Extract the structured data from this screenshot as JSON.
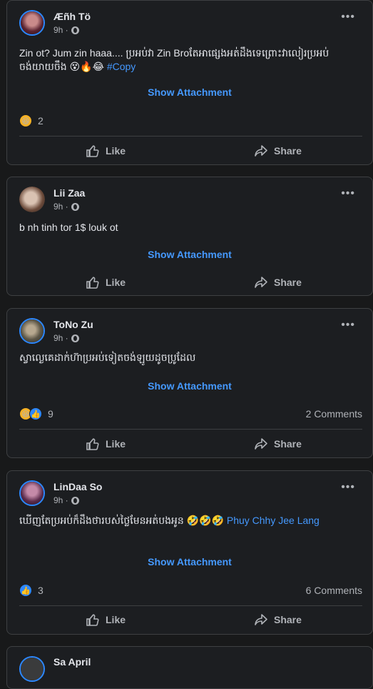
{
  "posts": [
    {
      "author": "Æñh Tö",
      "time": "9h ·",
      "text": "Zin ot? Jum zin haaa.... ប្រអប់វា Zin Broតែអាផ្សេងអត់ដឹងទេព្រោះវាលៀរប្រអប់ ចង់យាយចឹង 😵🔥😂",
      "tag": "#Copy",
      "attachment": "Show Attachment",
      "reaction_count": "2",
      "comments": "",
      "like_label": "Like",
      "share_label": "Share"
    },
    {
      "author": "Lii Zaa",
      "time": "9h ·",
      "text": "b nh tinh tor 1$ louk ot",
      "attachment": "Show Attachment",
      "like_label": "Like",
      "share_label": "Share"
    },
    {
      "author": "ToNo Zu",
      "time": "9h ·",
      "text": "ស្វាលេ្ងគេដាក់ហ៊ាប្រអប់ទៀតចង់ឡូយដូចប្រូដែល",
      "attachment": "Show Attachment",
      "reaction_count": "9",
      "comments": "2 Comments",
      "like_label": "Like",
      "share_label": "Share"
    },
    {
      "author": "LinDaa So",
      "time": "9h ·",
      "text": "ឃើញតែប្រអប់ក៏ដឹងថារបស់ថ្លៃមែនអត់បងអូន 🤣🤣🤣",
      "tag": "Phuy Chhy Jee Lang",
      "attachment": "Show Attachment",
      "reaction_count": "3",
      "comments": "6 Comments",
      "like_label": "Like",
      "share_label": "Share"
    },
    {
      "author": "Sa April"
    }
  ],
  "colors": {
    "background": "#18191a",
    "card": "#1c1e21",
    "link": "#4599ff",
    "muted": "#b0b3b8"
  },
  "icons": {
    "more": "more-horizontal-icon",
    "privacy": "globe-icon",
    "like": "thumbs-up-icon",
    "share": "share-arrow-icon",
    "haha": "haha-reaction-icon",
    "like_reaction": "like-reaction-icon"
  }
}
